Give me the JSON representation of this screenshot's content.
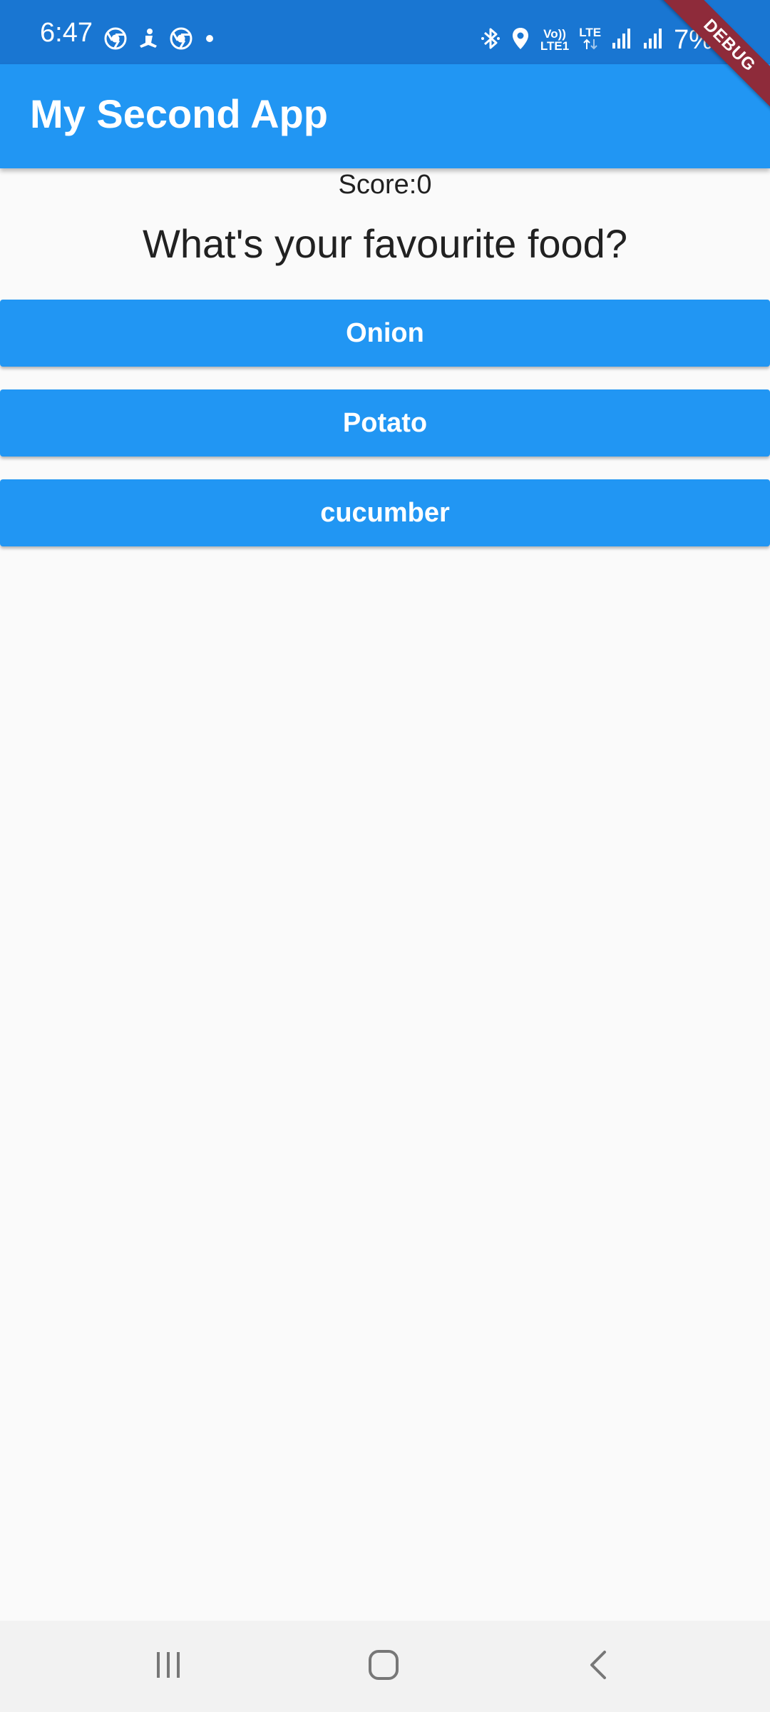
{
  "status_bar": {
    "time": "6:47",
    "left_icons": [
      "chrome-icon",
      "notification-icon",
      "chrome-icon",
      "dot-icon"
    ],
    "volte_top": "Vo))",
    "volte_bottom": "LTE1",
    "lte_label": "LTE",
    "battery": "7%",
    "right_icons": [
      "bluetooth-icon",
      "location-icon",
      "signal-icon",
      "signal-icon"
    ]
  },
  "debug_banner": "DEBUG",
  "app_bar": {
    "title": "My Second App"
  },
  "quiz": {
    "score": "Score:0",
    "question": "What's your favourite food?",
    "answers": [
      "Onion",
      "Potato",
      "cucumber"
    ]
  },
  "nav_bar": {
    "icons": [
      "recent-apps-icon",
      "home-icon",
      "back-icon"
    ]
  },
  "colors": {
    "status_bar": "#1976d2",
    "app_bar": "#2196f3",
    "button": "#2196f3",
    "background": "#fafafa",
    "text": "#212121",
    "debug_ribbon": "#8e2b3a"
  }
}
